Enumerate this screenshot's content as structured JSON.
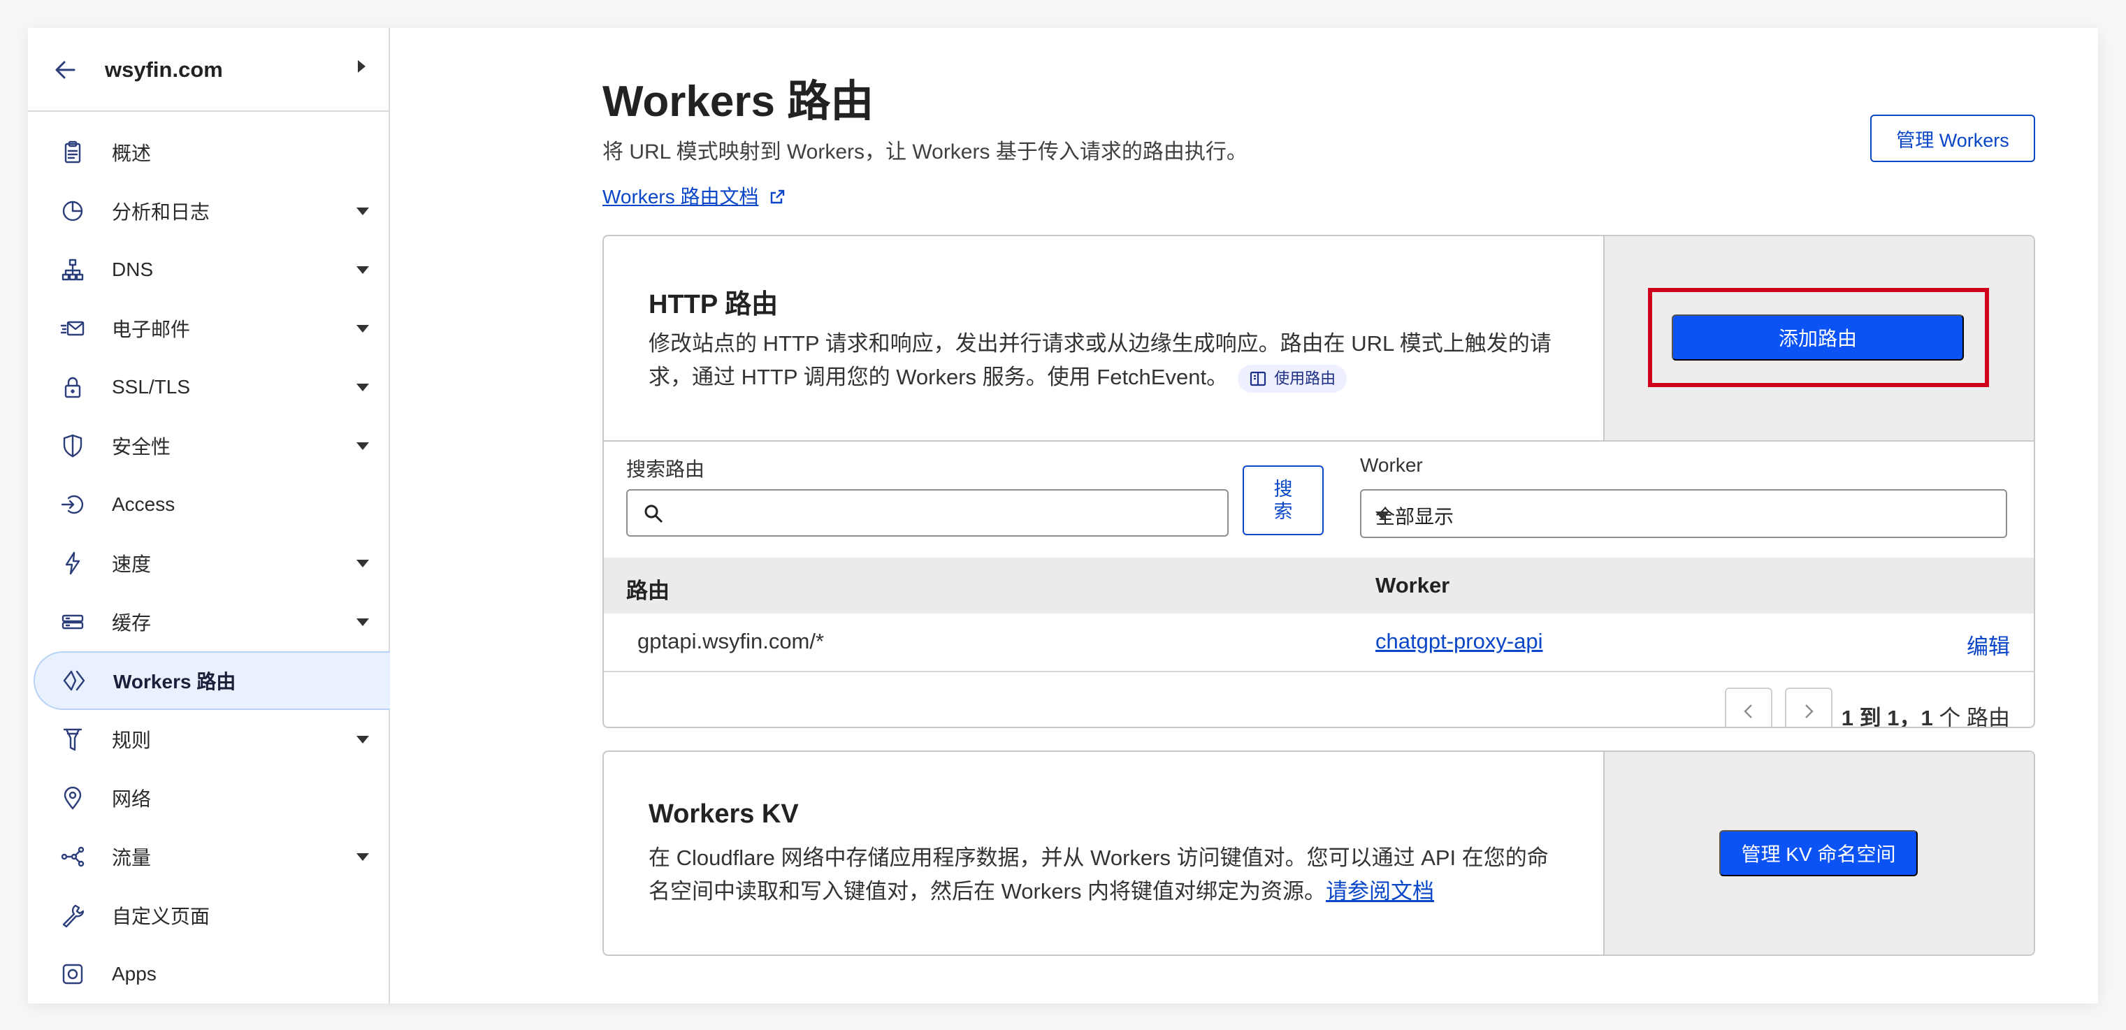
{
  "sidebar": {
    "zone": "wsyfin.com",
    "items": [
      {
        "label": "概述",
        "icon": "clipboard-icon",
        "caret": false
      },
      {
        "label": "分析和日志",
        "icon": "pie-chart-icon",
        "caret": true
      },
      {
        "label": "DNS",
        "icon": "network-icon",
        "caret": true
      },
      {
        "label": "电子邮件",
        "icon": "email-icon",
        "caret": true
      },
      {
        "label": "SSL/TLS",
        "icon": "lock-icon",
        "caret": true
      },
      {
        "label": "安全性",
        "icon": "shield-icon",
        "caret": true
      },
      {
        "label": "Access",
        "icon": "access-icon",
        "caret": false
      },
      {
        "label": "速度",
        "icon": "lightning-icon",
        "caret": true
      },
      {
        "label": "缓存",
        "icon": "storage-icon",
        "caret": true
      },
      {
        "label": "Workers 路由",
        "icon": "workers-icon",
        "caret": false,
        "active": true
      },
      {
        "label": "规则",
        "icon": "funnel-icon",
        "caret": true
      },
      {
        "label": "网络",
        "icon": "location-pin-icon",
        "caret": false
      },
      {
        "label": "流量",
        "icon": "traffic-icon",
        "caret": true
      },
      {
        "label": "自定义页面",
        "icon": "wrench-icon",
        "caret": false
      },
      {
        "label": "Apps",
        "icon": "apps-icon",
        "caret": false
      }
    ]
  },
  "header": {
    "title": "Workers 路由",
    "description": "将 URL 模式映射到 Workers，让 Workers 基于传入请求的路由执行。",
    "doc_link": "Workers 路由文档",
    "manage_button": "管理 Workers"
  },
  "http_card": {
    "title": "HTTP 路由",
    "description": "修改站点的 HTTP 请求和响应，发出并行请求或从边缘生成响应。路由在 URL 模式上触发的请求，通过 HTTP 调用您的 Workers 服务。使用 FetchEvent。",
    "pill": "使用路由",
    "add_button": "添加路由",
    "search_label": "搜索路由",
    "search_placeholder": "",
    "search_button": "搜索",
    "worker_label": "Worker",
    "worker_select": "全部显示",
    "columns": [
      "路由",
      "Worker"
    ],
    "rows": [
      {
        "route": "gptapi.wsyfin.com/*",
        "worker": "chatgpt-proxy-api",
        "action": "编辑"
      }
    ],
    "pager": {
      "range": "1 到 1，",
      "count": "1",
      "suffix": "个 路由"
    }
  },
  "kv_card": {
    "title": "Workers KV",
    "description": "在 Cloudflare 网络中存储应用程序数据，并从 Workers 访问键值对。您可以通过 API 在您的命名空间中读取和写入键值对，然后在 Workers 内将键值对绑定为资源。",
    "link": "请参阅文档",
    "button": "管理 KV 命名空间"
  },
  "colors": {
    "accent": "#0b53f5",
    "link": "#0a46c8",
    "highlight": "#d0021b",
    "active_bg": "#e8f1fd"
  }
}
